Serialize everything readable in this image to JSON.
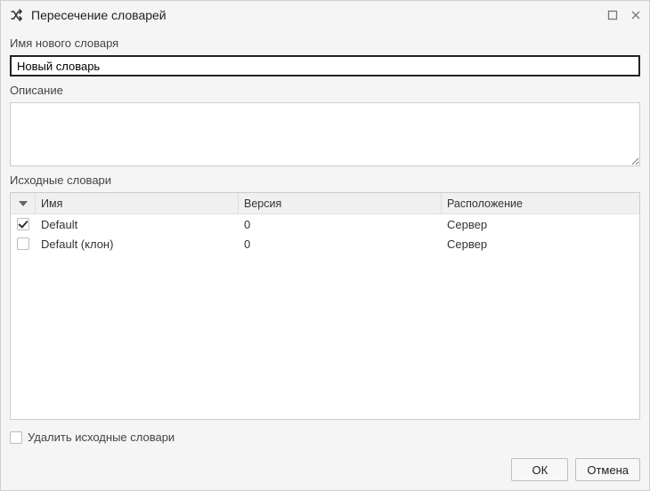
{
  "header": {
    "title": "Пересечение словарей"
  },
  "labels": {
    "new_name": "Имя нового словаря",
    "description": "Описание",
    "source_dicts": "Исходные словари",
    "delete_sources": "Удалить исходные словари"
  },
  "fields": {
    "name_value": "Новый словарь",
    "description_value": ""
  },
  "table": {
    "headers": {
      "name": "Имя",
      "version": "Версия",
      "location": "Расположение"
    },
    "rows": [
      {
        "checked": true,
        "name": "Default",
        "version": "0",
        "location": "Сервер"
      },
      {
        "checked": false,
        "name": "Default (клон)",
        "version": "0",
        "location": "Сервер"
      }
    ]
  },
  "delete_sources_checked": false,
  "buttons": {
    "ok": "ОК",
    "cancel": "Отмена"
  }
}
